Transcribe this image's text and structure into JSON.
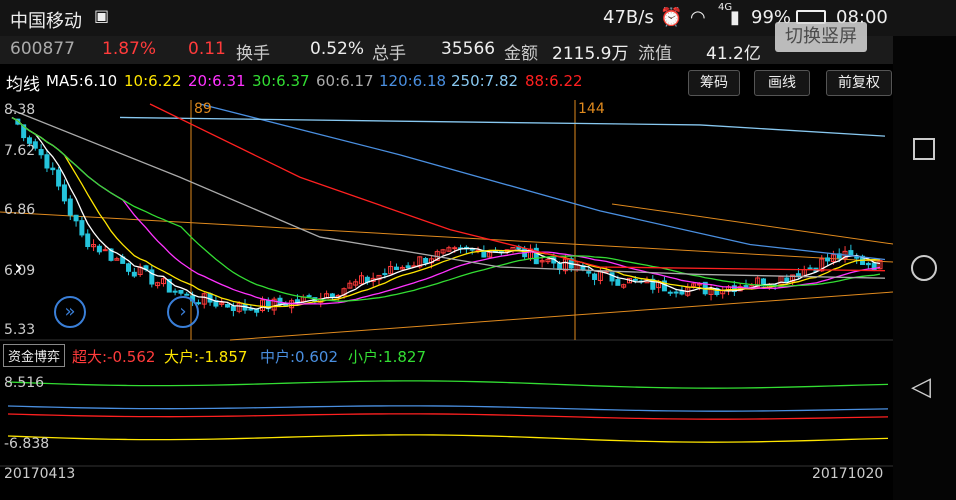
{
  "status": {
    "carrier": "中国移动",
    "speed": "47B/s",
    "net": "4G",
    "battery": "99%",
    "time": "08:00"
  },
  "quote": {
    "code": "600877",
    "pct": "1.87%",
    "chg": "0.11",
    "turnover_label": "换手",
    "turnover": "0.52%",
    "volume_label": "总手",
    "volume": "35566",
    "amount_label": "金额",
    "amount": "2115.9万",
    "float_label": "流值",
    "float_val": "41.2亿",
    "overlay": "切换竖屏"
  },
  "ma": {
    "title": "均线",
    "ma5": "MA5:6.10",
    "ma10": "10:6.22",
    "ma20": "20:6.31",
    "ma30": "30:6.37",
    "ma60": "60:6.17",
    "ma120": "120:6.18",
    "ma250": "250:7.82",
    "ma88": "88:6.22"
  },
  "buttons": {
    "chip": "筹码",
    "draw": "画线",
    "adjust": "前复权"
  },
  "axis": {
    "y_top": "8.38",
    "y_mid1": "7.62",
    "y_mid2": "6.86",
    "y_mid3": "6.09",
    "y_bot": "5.33",
    "marker1": "89",
    "marker2": "144",
    "fund_top": "8.516",
    "fund_bot": "-6.838",
    "date_start": "20170413",
    "date_end": "20171020"
  },
  "fund": {
    "title": "资金博弈",
    "super": "超大:-0.562",
    "big": "大户:-1.857",
    "mid": "中户:0.602",
    "small": "小户:1.827"
  },
  "colors": {
    "up": "#ff3b3b",
    "down": "#25c4dc",
    "ma5": "#ffffff",
    "ma10": "#ffe600",
    "ma20": "#ff33ff",
    "ma30": "#33dd33",
    "ma60": "#aaaaaa",
    "ma120": "#4a8fe0",
    "ma250": "#88c8f0",
    "ma88": "#ff2020",
    "fib": "#e08a1e"
  }
}
